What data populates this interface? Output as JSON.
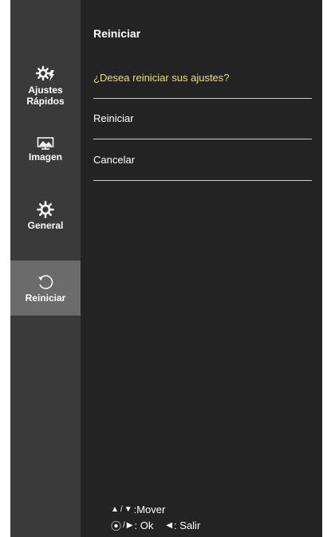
{
  "sidebar": {
    "items": [
      {
        "label1": "Ajustes",
        "label2": "Rápidos",
        "icon": "quick-settings-icon"
      },
      {
        "label": "Imagen",
        "icon": "image-icon"
      },
      {
        "label": "General",
        "icon": "gear-icon"
      },
      {
        "label": "Reiniciar",
        "icon": "reset-icon",
        "active": true
      }
    ]
  },
  "main": {
    "title": "Reiniciar",
    "question": "¿Desea reiniciar sus ajustes?",
    "options": [
      "Reiniciar",
      "Cancelar"
    ]
  },
  "help": {
    "move_label": ":Mover",
    "ok_label": ": Ok",
    "exit_label": ": Salir"
  },
  "colors": {
    "question": "#e6e64a",
    "sidebar_bg": "#3a3a3a",
    "active_bg": "#6b6b6b",
    "panel_bg": "#232323"
  }
}
